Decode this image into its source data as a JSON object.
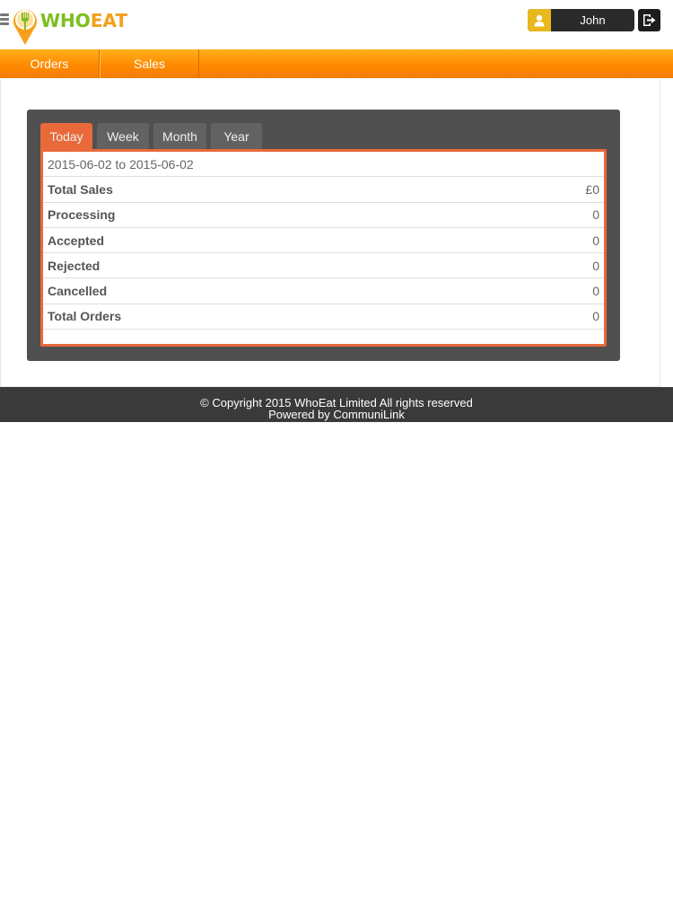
{
  "header": {
    "logo": {
      "part1": "WHO",
      "part2": "EAT"
    },
    "user_name": "John"
  },
  "nav": {
    "items": [
      {
        "label": "Orders"
      },
      {
        "label": "Sales"
      }
    ]
  },
  "stats": {
    "tabs": [
      {
        "label": "Today",
        "active": true
      },
      {
        "label": "Week",
        "active": false
      },
      {
        "label": "Month",
        "active": false
      },
      {
        "label": "Year",
        "active": false
      }
    ],
    "date_range": "2015-06-02 to 2015-06-02",
    "rows": [
      {
        "label": "Total Sales",
        "value": "£0"
      },
      {
        "label": "Processing",
        "value": "0"
      },
      {
        "label": "Accepted",
        "value": "0"
      },
      {
        "label": "Rejected",
        "value": "0"
      },
      {
        "label": "Cancelled",
        "value": "0"
      },
      {
        "label": "Total Orders",
        "value": "0"
      }
    ]
  },
  "footer": {
    "copyright": "© Copyright 2015 WhoEat Limited All rights reserved",
    "powered_by": "Powered by CommuniLink"
  },
  "colors": {
    "accent_orange": "#ff8a00",
    "tab_active": "#e9693a",
    "panel_bg": "#505050",
    "footer_bg": "#3a3a3a",
    "user_icon_bg": "#e8b81c"
  },
  "icons": {
    "menu": "hamburger-icon",
    "logo": "location-pin-fork-icon",
    "user": "user-icon",
    "logout": "logout-icon"
  }
}
